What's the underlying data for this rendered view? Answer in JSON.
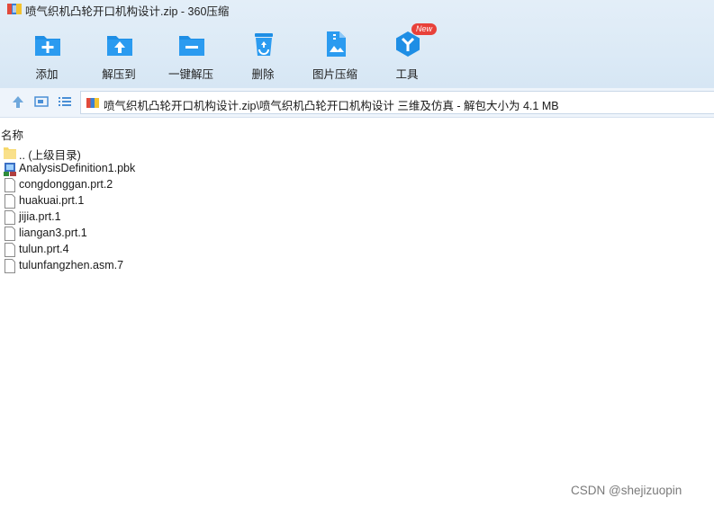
{
  "window": {
    "title": "喷气织机凸轮开口机构设计.zip - 360压缩"
  },
  "toolbar": {
    "items": [
      {
        "label": "添加",
        "icon": "add-icon"
      },
      {
        "label": "解压到",
        "icon": "extract-to-icon"
      },
      {
        "label": "一键解压",
        "icon": "one-click-extract-icon"
      },
      {
        "label": "删除",
        "icon": "recycle-bin-icon"
      },
      {
        "label": "图片压缩",
        "icon": "image-compress-icon"
      },
      {
        "label": "工具",
        "icon": "tools-icon",
        "badge": "New"
      }
    ]
  },
  "address": {
    "path": "喷气织机凸轮开口机构设计.zip\\喷气织机凸轮开口机构设计 三维及仿真 - 解包大小为 4.1 MB"
  },
  "list": {
    "column_name": "名称",
    "items": [
      {
        "name": ".. (上级目录)",
        "type": "parent-folder"
      },
      {
        "name": "AnalysisDefinition1.pbk",
        "type": "pbk"
      },
      {
        "name": "congdonggan.prt.2",
        "type": "file"
      },
      {
        "name": "huakuai.prt.1",
        "type": "file"
      },
      {
        "name": "jijia.prt.1",
        "type": "file"
      },
      {
        "name": "liangan3.prt.1",
        "type": "file"
      },
      {
        "name": "tulun.prt.4",
        "type": "file"
      },
      {
        "name": "tulunfangzhen.asm.7",
        "type": "file"
      }
    ]
  },
  "watermark": "CSDN @shejizuopin",
  "colors": {
    "accent": "#1e8ee5",
    "toolbar_bg": "#dceaf6",
    "badge": "#e8413a",
    "folder": "#f6d86b"
  }
}
